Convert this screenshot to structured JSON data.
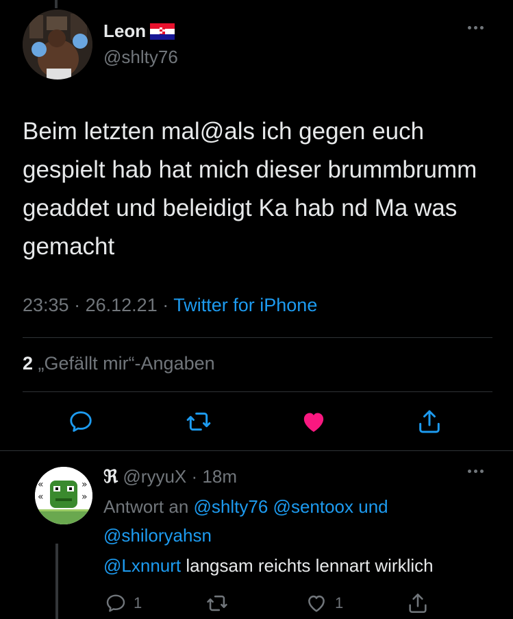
{
  "tweet": {
    "author_name": "Leon",
    "author_handle": "@shlty76",
    "text": "Beim letzten mal@als ich gegen euch gespielt hab hat mich dieser brummbrumm geaddet und beleidigt Ka hab nd Ma was gemacht",
    "time": "23:35",
    "separator": "·",
    "date": "26.12.21",
    "source": "Twitter for iPhone",
    "like_count": "2",
    "like_label": "„Gefällt mir“-Angaben",
    "liked": true,
    "colors": {
      "accent": "#1d9bf0",
      "like": "#f91880",
      "background": "#000000",
      "muted": "#71767b"
    },
    "actions": [
      "reply-icon",
      "retweet-icon",
      "heart-filled-icon",
      "share-icon"
    ]
  },
  "reply": {
    "name_glyph": "ℜ",
    "handle": "@ryyuX",
    "separator": "·",
    "age": "18m",
    "reply_prefix": "Antwort an",
    "mention_1": "@shlty76",
    "mention_2": "@sentoox",
    "conjunction": "und",
    "mention_3": "@shiloryahsn",
    "text_mention": "@Lxnnurt",
    "text": "langsam reichts lennart wirklich",
    "reply_count": "1",
    "like_count": "1"
  }
}
